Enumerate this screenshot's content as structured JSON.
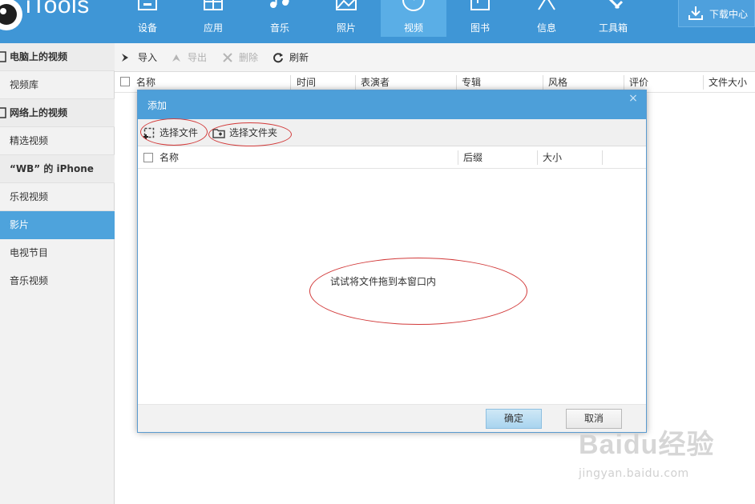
{
  "app": {
    "logo_text": "iTools"
  },
  "nav": {
    "items": [
      {
        "label": "设备",
        "icon": "device-icon"
      },
      {
        "label": "应用",
        "icon": "apps-icon"
      },
      {
        "label": "音乐",
        "icon": "music-icon"
      },
      {
        "label": "照片",
        "icon": "photo-icon"
      },
      {
        "label": "视频",
        "icon": "video-icon",
        "active": true
      },
      {
        "label": "图书",
        "icon": "book-icon"
      },
      {
        "label": "信息",
        "icon": "message-icon"
      },
      {
        "label": "工具箱",
        "icon": "toolbox-icon"
      }
    ],
    "download_center": "下载中心"
  },
  "sidebar": {
    "rows": [
      {
        "label": "电脑上的视频",
        "type": "head"
      },
      {
        "label": "视频库",
        "type": "item"
      },
      {
        "label": "网络上的视频",
        "type": "head"
      },
      {
        "label": "精选视频",
        "type": "item"
      },
      {
        "label": "“WB” 的 iPhone",
        "type": "head"
      },
      {
        "label": "乐视视频",
        "type": "item"
      },
      {
        "label": "影片",
        "type": "item",
        "active": true
      },
      {
        "label": "电视节目",
        "type": "item"
      },
      {
        "label": "音乐视频",
        "type": "item"
      }
    ]
  },
  "toolbar": {
    "import": "导入",
    "export": "导出",
    "delete": "删除",
    "refresh": "刷新"
  },
  "table": {
    "columns": [
      "名称",
      "时间",
      "表演者",
      "专辑",
      "风格",
      "评价",
      "文件大小"
    ]
  },
  "dialog": {
    "title": "添加",
    "close": "×",
    "select_file": "选择文件",
    "select_folder": "选择文件夹",
    "columns": [
      "名称",
      "后缀",
      "大小"
    ],
    "drop_hint": "试试将文件拖到本窗口内",
    "ok": "确定",
    "cancel": "取消"
  },
  "colors": {
    "topbar": "#3f96d6",
    "accent": "#4ea3dc",
    "annotation": "#d23a3a"
  },
  "watermark": {
    "brand": "Baidu经验",
    "url": "jingyan.baidu.com"
  }
}
